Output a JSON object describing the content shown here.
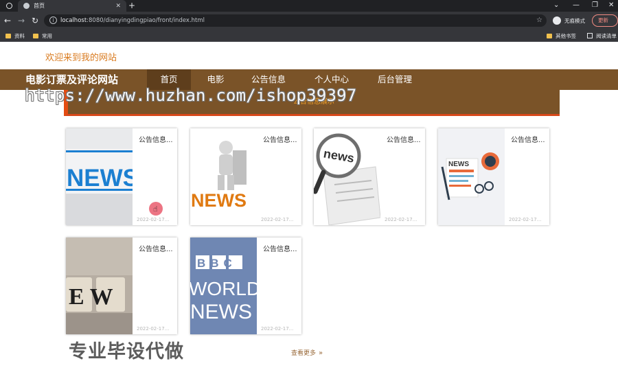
{
  "browser": {
    "active_tab_title": "首页",
    "new_tab": "+",
    "url_host": "localhost",
    "url_rest": ":8080/dianyingdingpiao/front/index.html",
    "incognito_label": "无痕模式",
    "update_label": "更新",
    "bookmarks": [
      {
        "label": "资料"
      },
      {
        "label": "常用"
      }
    ],
    "other_bookmarks": "其他书签",
    "reading_list": "阅读清单"
  },
  "site": {
    "welcome": "欢迎来到我的网站",
    "brand": "电影订票及评论网站",
    "nav": [
      {
        "label": "首页",
        "active": true
      },
      {
        "label": "电影",
        "active": false
      },
      {
        "label": "公告信息",
        "active": false
      },
      {
        "label": "个人中心",
        "active": false
      },
      {
        "label": "后台管理",
        "active": false
      }
    ],
    "section_title": "公告信息展示",
    "watermark_url": "https://www.huzhan.com/ishop39397",
    "watermark_text": "专业毕设代做",
    "more_label": "查看更多",
    "cards": [
      {
        "title": "公告信息...",
        "date": "2022-02-17..."
      },
      {
        "title": "公告信息...",
        "date": "2022-02-17..."
      },
      {
        "title": "公告信息...",
        "date": "2022-02-17..."
      },
      {
        "title": "公告信息...",
        "date": "2022-02-17..."
      },
      {
        "title": "公告信息...",
        "date": "2022-02-17..."
      },
      {
        "title": "公告信息...",
        "date": "2022-02-17..."
      }
    ],
    "card_images": [
      {
        "word": "NEWS"
      },
      {
        "word": "NEWS"
      },
      {
        "word": "news"
      },
      {
        "word": "NEWS"
      },
      {
        "word": "E W"
      },
      {
        "line1": "BBC",
        "line2": "WORLD",
        "line3": "NEWS"
      }
    ]
  }
}
